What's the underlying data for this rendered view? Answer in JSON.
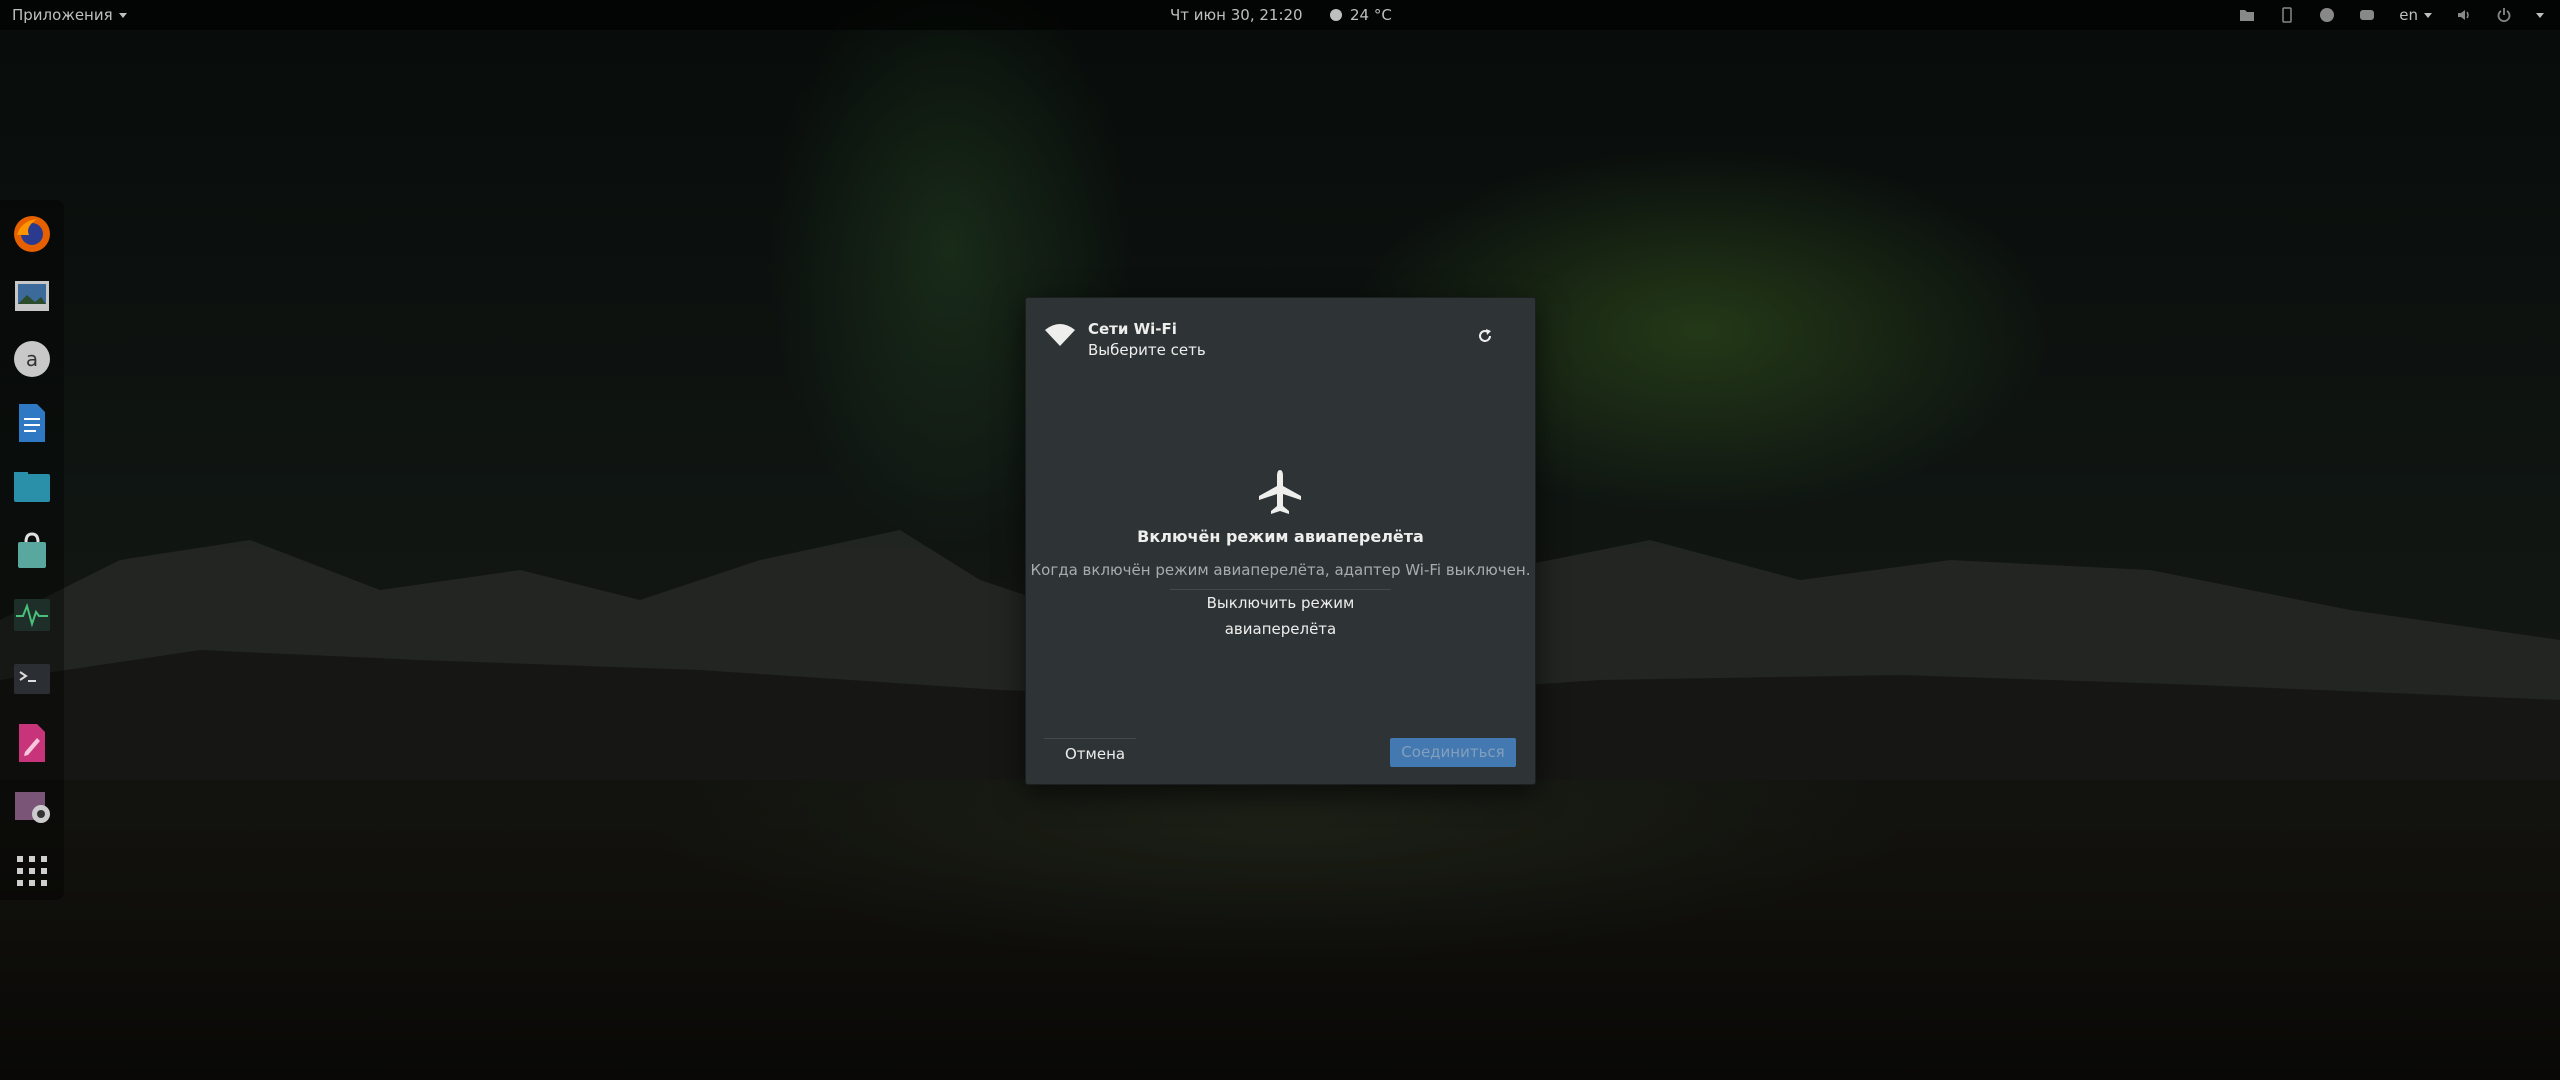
{
  "topbar": {
    "activities_label": "Приложения",
    "clock": "Чт июн 30, 21:20",
    "weather": "24 °C",
    "language": "en"
  },
  "dock": {
    "items": [
      "firefox-icon",
      "image-viewer-icon",
      "amazon-icon",
      "text-document-icon",
      "files-icon",
      "software-icon",
      "system-monitor-icon",
      "terminal-icon",
      "notes-icon",
      "screenshot-icon",
      "app-grid-icon"
    ]
  },
  "dialog": {
    "title": "Сети Wi-Fi",
    "subtitle": "Выберите сеть",
    "airplane_title": "Включён режим авиаперелёта",
    "airplane_desc": "Когда включён режим авиаперелёта, адаптер Wi-Fi выключен.",
    "turn_off_label": "Выключить режим авиаперелёта",
    "cancel_label": "Отмена",
    "connect_label": "Соединиться"
  },
  "colors": {
    "dialog_bg": "#2e3436",
    "accent": "#4a90d9",
    "text": "#eeeeec",
    "dim_text": "#a8acab"
  }
}
